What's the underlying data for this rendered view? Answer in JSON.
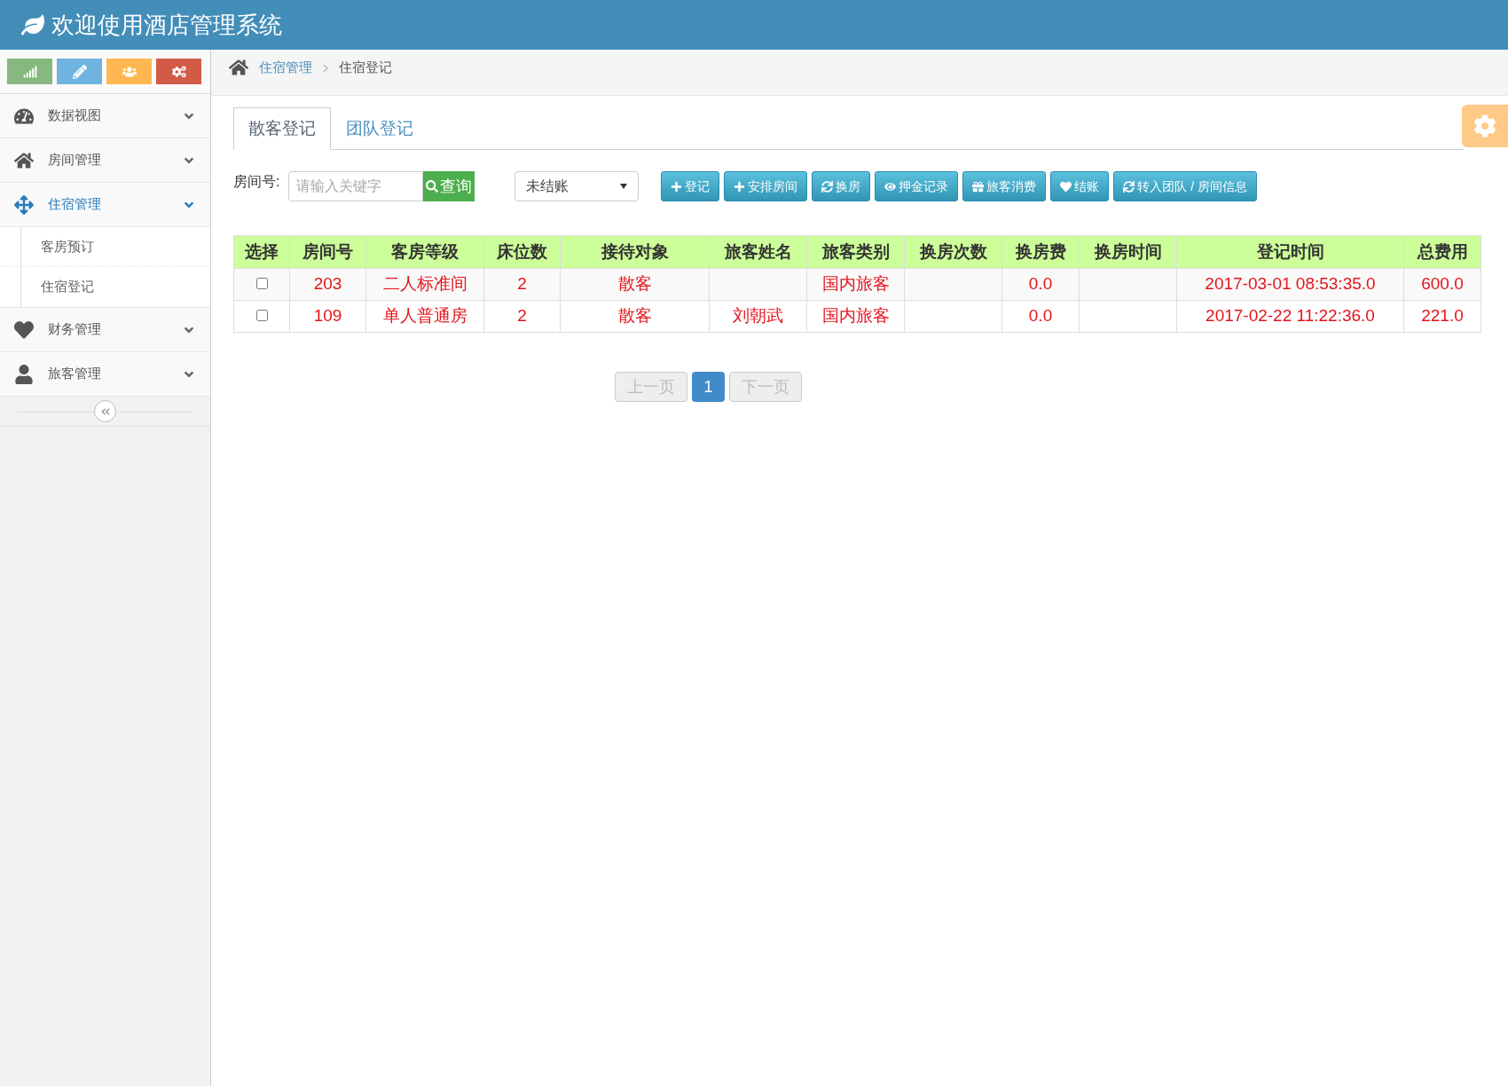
{
  "header": {
    "title": "欢迎使用酒店管理系统"
  },
  "shortcuts": [
    {
      "color": "#87b87f"
    },
    {
      "color": "#6fb3e0"
    },
    {
      "color": "#ffb752"
    },
    {
      "color": "#d15b47"
    }
  ],
  "sidebar": {
    "items": [
      {
        "label": "数据视图",
        "selected": false,
        "expanded": false
      },
      {
        "label": "房间管理",
        "selected": false,
        "expanded": false
      },
      {
        "label": "住宿管理",
        "selected": true,
        "expanded": true,
        "children": [
          {
            "label": "客房预订"
          },
          {
            "label": "住宿登记"
          }
        ]
      },
      {
        "label": "财务管理",
        "selected": false,
        "expanded": false
      },
      {
        "label": "旅客管理",
        "selected": false,
        "expanded": false
      }
    ]
  },
  "breadcrumb": [
    {
      "label": "住宿管理",
      "kind": "link"
    },
    {
      "label": "住宿登记",
      "kind": "current"
    }
  ],
  "tabs": [
    {
      "label": "散客登记",
      "selected": true
    },
    {
      "label": "团队登记",
      "selected": false
    }
  ],
  "search": {
    "label": "房间号:",
    "placeholder": "请输入关键字",
    "button": "查询"
  },
  "status_select": {
    "value": "未结账"
  },
  "actions": [
    "登记",
    "安排房间",
    "换房",
    "押金记录",
    "旅客消费",
    "结账",
    "转入团队 / 房间信息"
  ],
  "table": {
    "columns": [
      "选择",
      "房间号",
      "客房等级",
      "床位数",
      "接待对象",
      "旅客姓名",
      "旅客类别",
      "换房次数",
      "换房费",
      "换房时间",
      "登记时间",
      "总费用"
    ],
    "rows": [
      {
        "checked": false,
        "cells": [
          "",
          "203",
          "二人标准间",
          "2",
          "散客",
          "",
          "国内旅客",
          "",
          "0.0",
          "",
          "2017-03-01 08:53:35.0",
          "600.0"
        ]
      },
      {
        "checked": false,
        "cells": [
          "",
          "109",
          "单人普通房",
          "2",
          "散客",
          "刘朝武",
          "国内旅客",
          "",
          "0.0",
          "",
          "2017-02-22 11:22:36.0",
          "221.0"
        ]
      }
    ]
  },
  "pagination": {
    "prev": {
      "label": "上一页",
      "disabled": true
    },
    "pages": [
      {
        "label": "1",
        "selected": true
      }
    ],
    "next": {
      "label": "下一页",
      "disabled": true
    }
  }
}
